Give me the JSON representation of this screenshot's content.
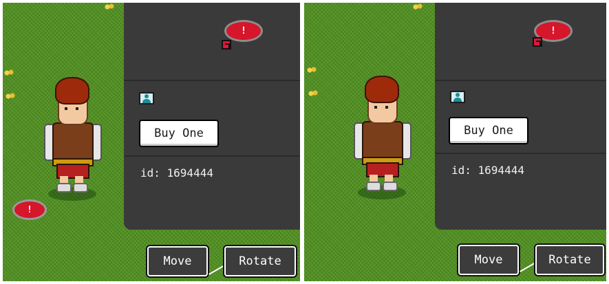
{
  "panels": [
    {
      "badge_mark": "!",
      "buy_label": "Buy One",
      "id_text": "id: 1694444",
      "ground_badge_mark": "!",
      "move_label": "Move",
      "rotate_label": "Rotate"
    },
    {
      "badge_mark": "!",
      "buy_label": "Buy One",
      "id_text": "id: 1694444",
      "move_label": "Move",
      "rotate_label": "Rotate"
    }
  ],
  "colors": {
    "grass": "#4f8f1f",
    "panel": "#3a3a3a",
    "badge_red": "#d5162b",
    "button_bg": "#ffffff",
    "action_bg": "#3c3c3c"
  },
  "icons": [
    "badge-icon",
    "external-link-icon",
    "user-icon",
    "flower-icon",
    "arrow-icon"
  ]
}
